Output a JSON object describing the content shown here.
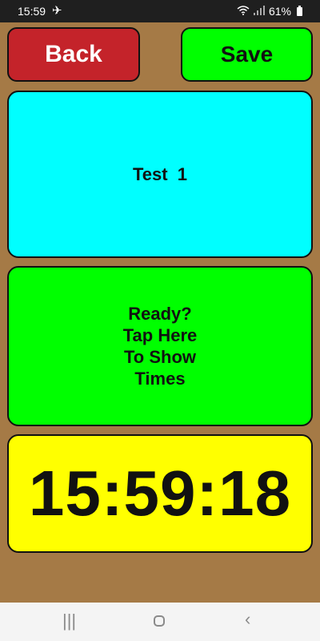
{
  "status_bar": {
    "time": "15:59",
    "airplane_icon": "airplane-icon",
    "battery": "61%"
  },
  "toolbar": {
    "back_label": "Back",
    "save_label": "Save"
  },
  "test_panel": {
    "label": "Test  1"
  },
  "ready_panel": {
    "label": "Ready?\nTap Here\nTo Show\nTimes"
  },
  "clock": {
    "time": "15:59:18"
  },
  "colors": {
    "background": "#a57a46",
    "back_button": "#c4232a",
    "save_button": "#00ff00",
    "test_panel": "#00ffff",
    "ready_panel": "#00ff00",
    "clock_panel": "#ffff00"
  },
  "nav_bar": {
    "recent_icon": "recent-apps-icon",
    "home_icon": "home-icon",
    "back_icon": "back-icon"
  }
}
